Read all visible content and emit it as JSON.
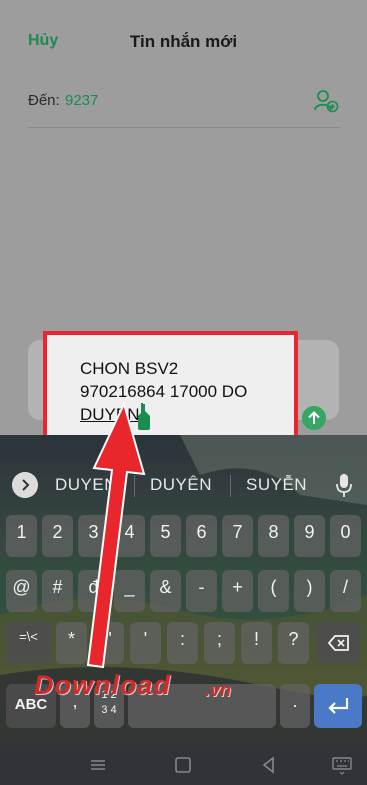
{
  "header": {
    "cancel_label": "Hủy",
    "title": "Tin nhắn mới"
  },
  "recipient": {
    "label": "Đến:",
    "value": "9237",
    "add_contact_icon": "add-contact-icon"
  },
  "compose": {
    "lines": [
      "CHON BSV2",
      "970216864 17000 DO",
      "DUYEN"
    ],
    "attach_icon": "plus-icon",
    "send_icon": "send-arrow-icon"
  },
  "keyboard": {
    "suggestions": [
      "DUYEN",
      "DUYÊN",
      "SUYỄN"
    ],
    "row_numbers": [
      "1",
      "2",
      "3",
      "4",
      "5",
      "6",
      "7",
      "8",
      "9",
      "0"
    ],
    "row_symbols1": [
      "@",
      "#",
      "đ",
      "_",
      "&",
      "-",
      "+",
      "(",
      ")",
      "/"
    ],
    "row_symbols2": [
      "=\\<",
      "*",
      "\"",
      "'",
      ":",
      ";",
      "!",
      "?"
    ],
    "bottom": {
      "abc": "ABC",
      "comma": ",",
      "numpad_top": "1 2",
      "numpad_bottom": "3 4",
      "period": "."
    }
  },
  "watermark": {
    "text": "Download",
    "suffix": ".vn"
  },
  "colors": {
    "accent_green": "#1b8c52",
    "highlight_red": "#e8262b",
    "enter_blue": "#4a7ac7"
  }
}
